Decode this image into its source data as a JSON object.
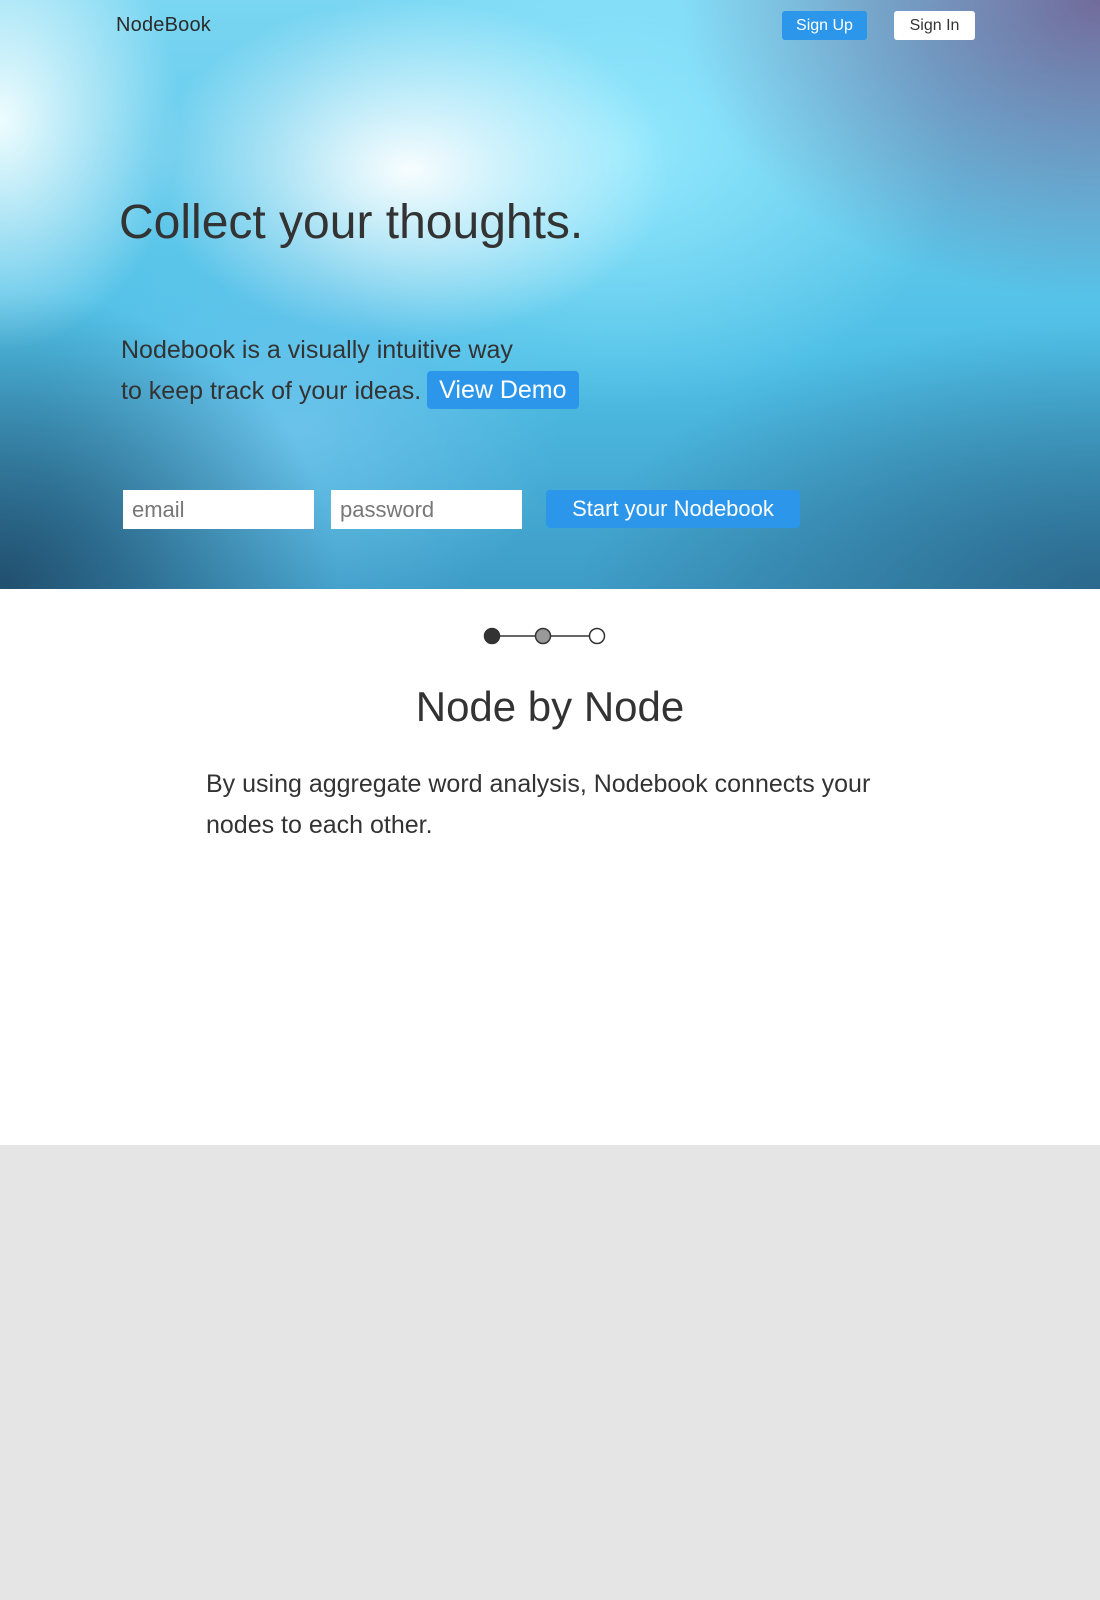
{
  "header": {
    "brand": "NodeBook",
    "sign_up_label": "Sign Up",
    "sign_in_label": "Sign In"
  },
  "hero": {
    "title": "Collect your thoughts.",
    "description_line1": "Nodebook is a visually intuitive way",
    "description_line2": "to keep track of your ideas.",
    "view_demo_label": "View Demo"
  },
  "signup_form": {
    "email_placeholder": "email",
    "password_placeholder": "password",
    "submit_label": "Start your Nodebook"
  },
  "stepper": {
    "total_steps": 3,
    "current_step": 1,
    "colors": {
      "active": "#333333",
      "visited": "#999999",
      "pending": "#ffffff",
      "line": "#333333"
    }
  },
  "feature": {
    "title": "Node by Node",
    "description": "By using aggregate word analysis, Nodebook connects your nodes to each other."
  },
  "colors": {
    "accent": "#2c97ea",
    "text": "#333333",
    "footer_bg": "#e5e5e5"
  }
}
